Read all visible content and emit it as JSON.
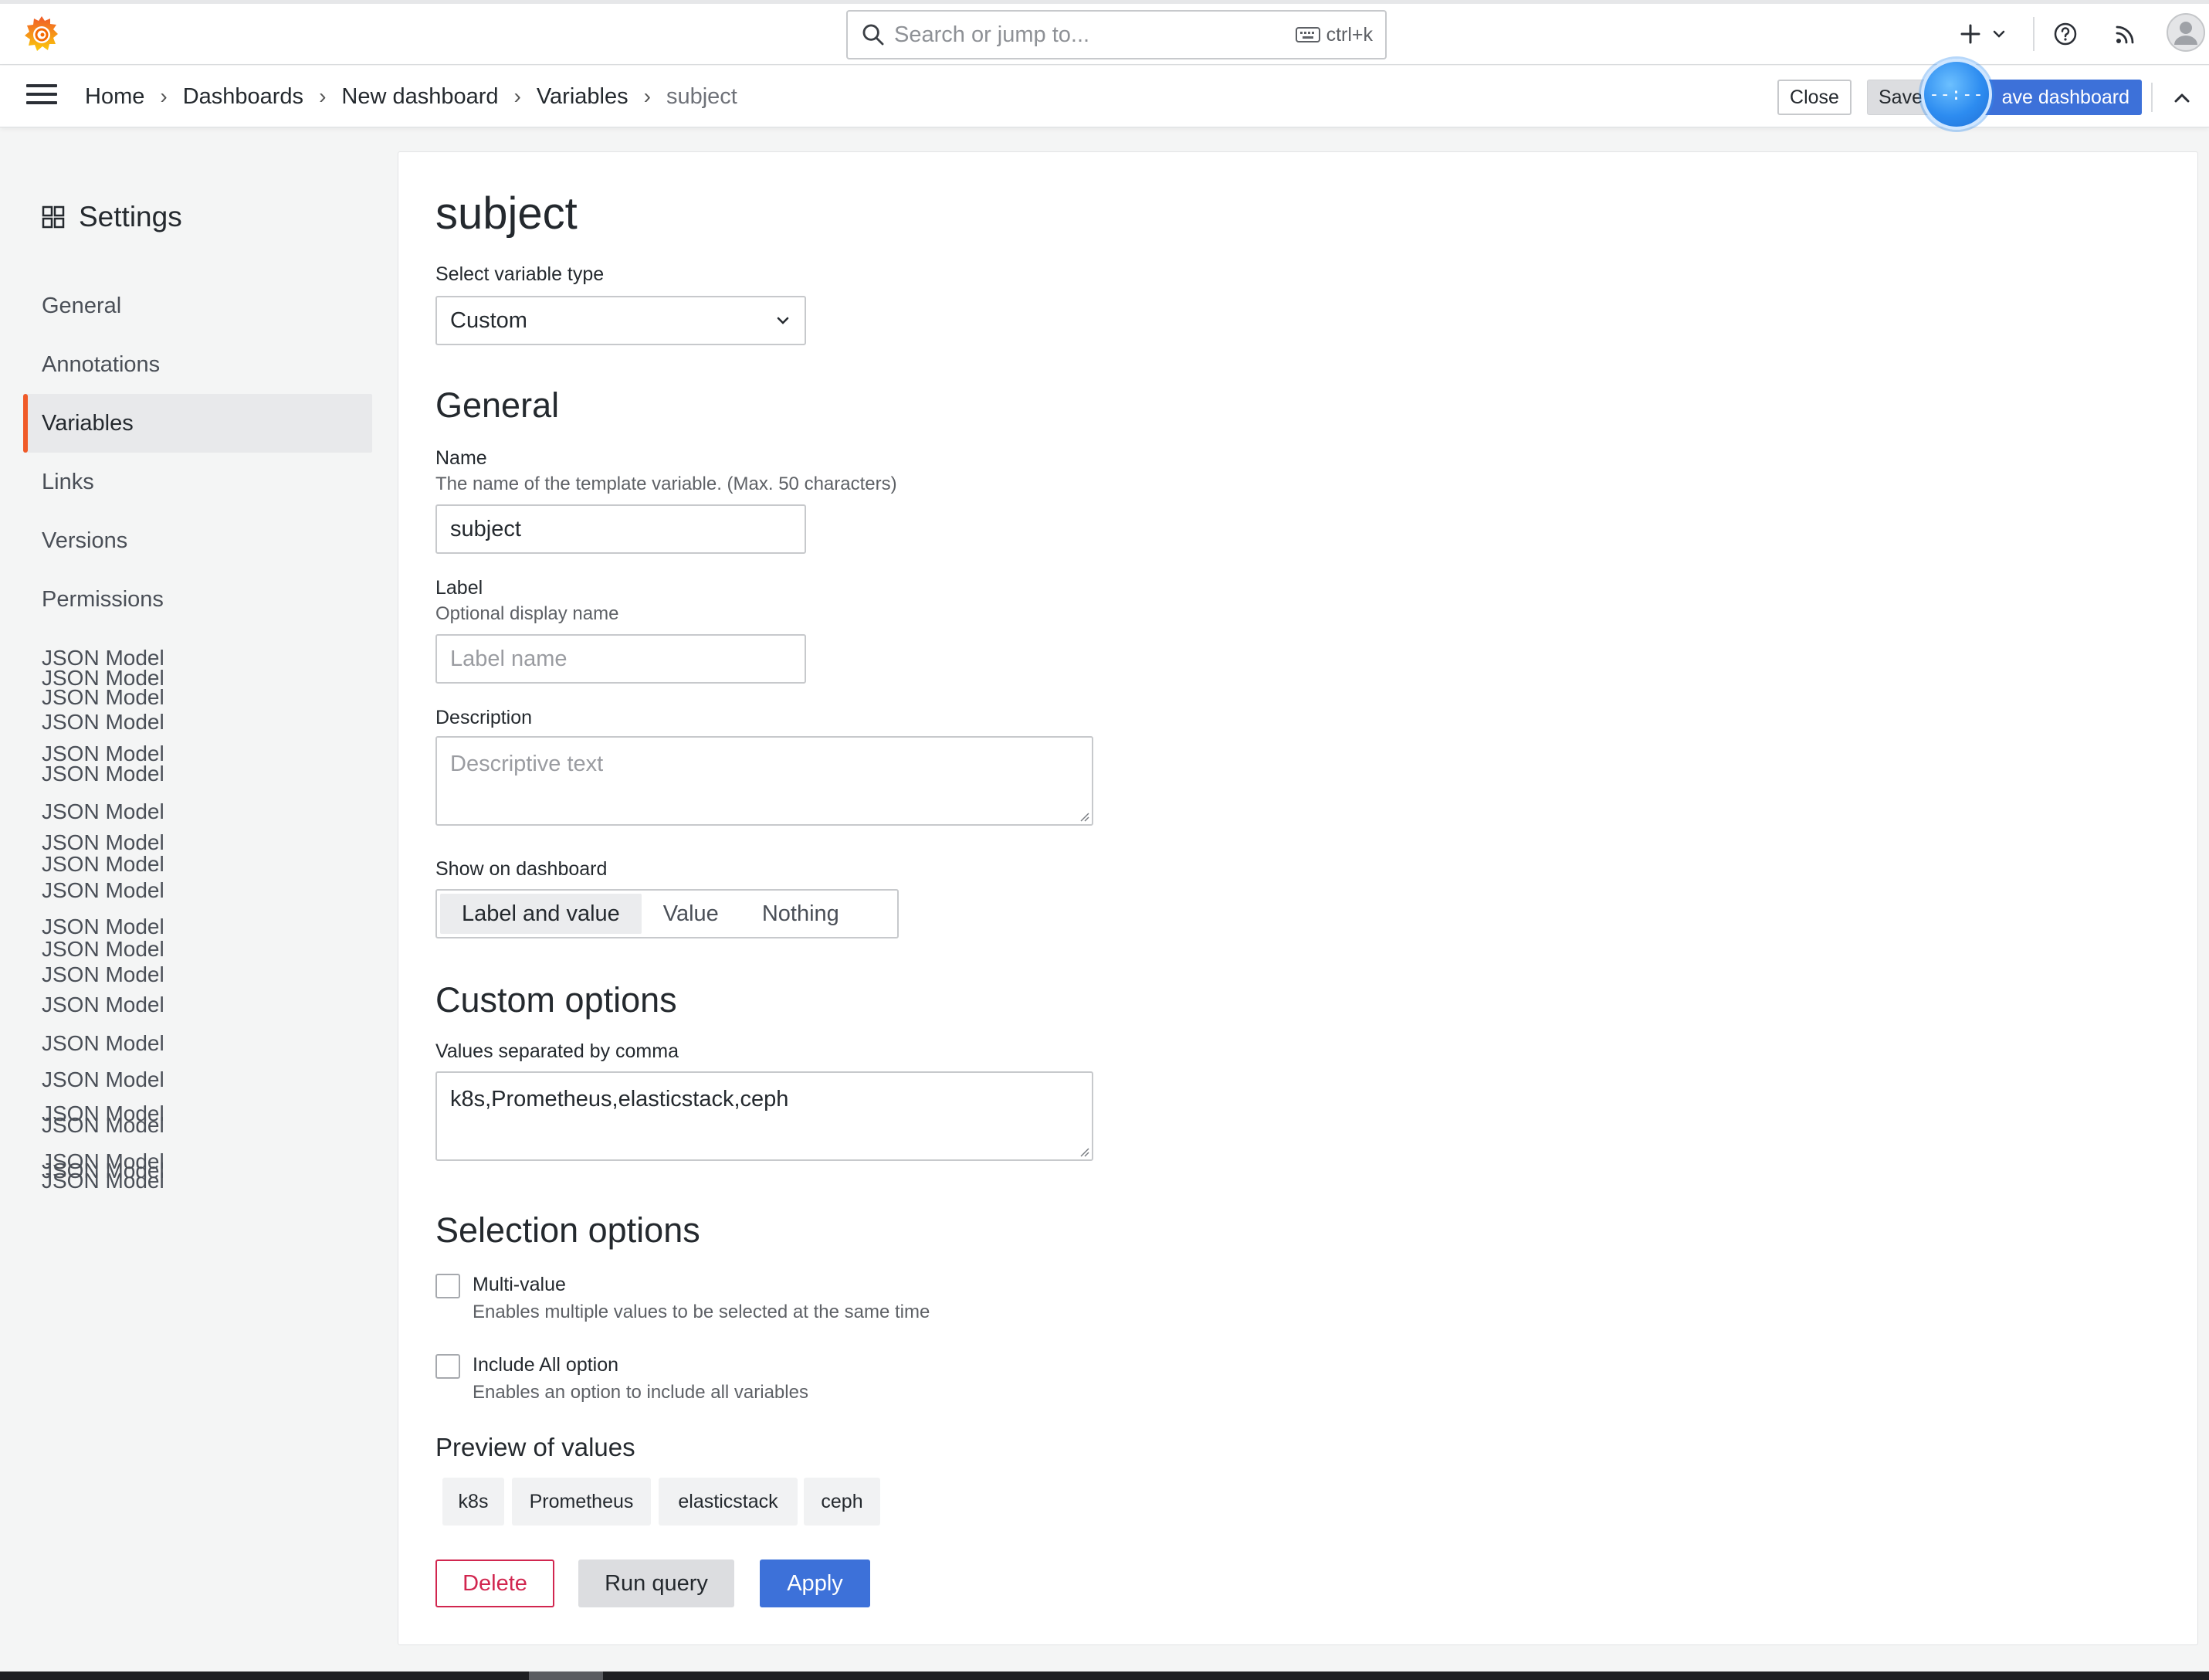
{
  "topbar": {
    "search_placeholder": "Search or jump to...",
    "search_shortcut": "ctrl+k",
    "icons": [
      "grafana-logo-icon",
      "search-icon",
      "keyboard-icon",
      "plus-icon",
      "chevron-down-icon",
      "help-icon",
      "rss-icon",
      "avatar-icon"
    ]
  },
  "breadcrumb": {
    "items": [
      "Home",
      "Dashboards",
      "New dashboard",
      "Variables",
      "subject"
    ],
    "separator": "›"
  },
  "nav_actions": {
    "close_label": "Close",
    "save_label": "Save",
    "save_dashboard_label": "ave dashboard",
    "recorder_label": "--:--"
  },
  "sidebar": {
    "title": "Settings",
    "items": [
      {
        "label": "General",
        "active": false
      },
      {
        "label": "Annotations",
        "active": false
      },
      {
        "label": "Variables",
        "active": true
      },
      {
        "label": "Links",
        "active": false
      },
      {
        "label": "Versions",
        "active": false
      },
      {
        "label": "Permissions",
        "active": false
      }
    ],
    "json_model_label": "JSON Model"
  },
  "editor": {
    "title": "subject",
    "variable_type": {
      "label": "Select variable type",
      "value": "Custom"
    },
    "general_heading": "General",
    "name": {
      "label": "Name",
      "description": "The name of the template variable. (Max. 50 characters)",
      "value": "subject"
    },
    "label_field": {
      "label": "Label",
      "description": "Optional display name",
      "placeholder": "Label name"
    },
    "description_field": {
      "label": "Description",
      "placeholder": "Descriptive text"
    },
    "show_on_dashboard": {
      "label": "Show on dashboard",
      "options": [
        "Label and value",
        "Value",
        "Nothing"
      ],
      "selected": "Label and value"
    },
    "custom_heading": "Custom options",
    "values_field": {
      "label": "Values separated by comma",
      "value": "k8s,Prometheus,elasticstack,ceph"
    },
    "selection_heading": "Selection options",
    "multi_value": {
      "label": "Multi-value",
      "description": "Enables multiple values to be selected at the same time",
      "checked": false
    },
    "include_all": {
      "label": "Include All option",
      "description": "Enables an option to include all variables",
      "checked": false
    },
    "preview_heading": "Preview of values",
    "preview_values": [
      "k8s",
      "Prometheus",
      "elasticstack",
      "ceph"
    ],
    "buttons": {
      "delete": "Delete",
      "run_query": "Run query",
      "apply": "Apply"
    }
  },
  "colors": {
    "accent_blue": "#3d71d9",
    "active_indicator": "#f05a28",
    "danger": "#d1264f"
  }
}
